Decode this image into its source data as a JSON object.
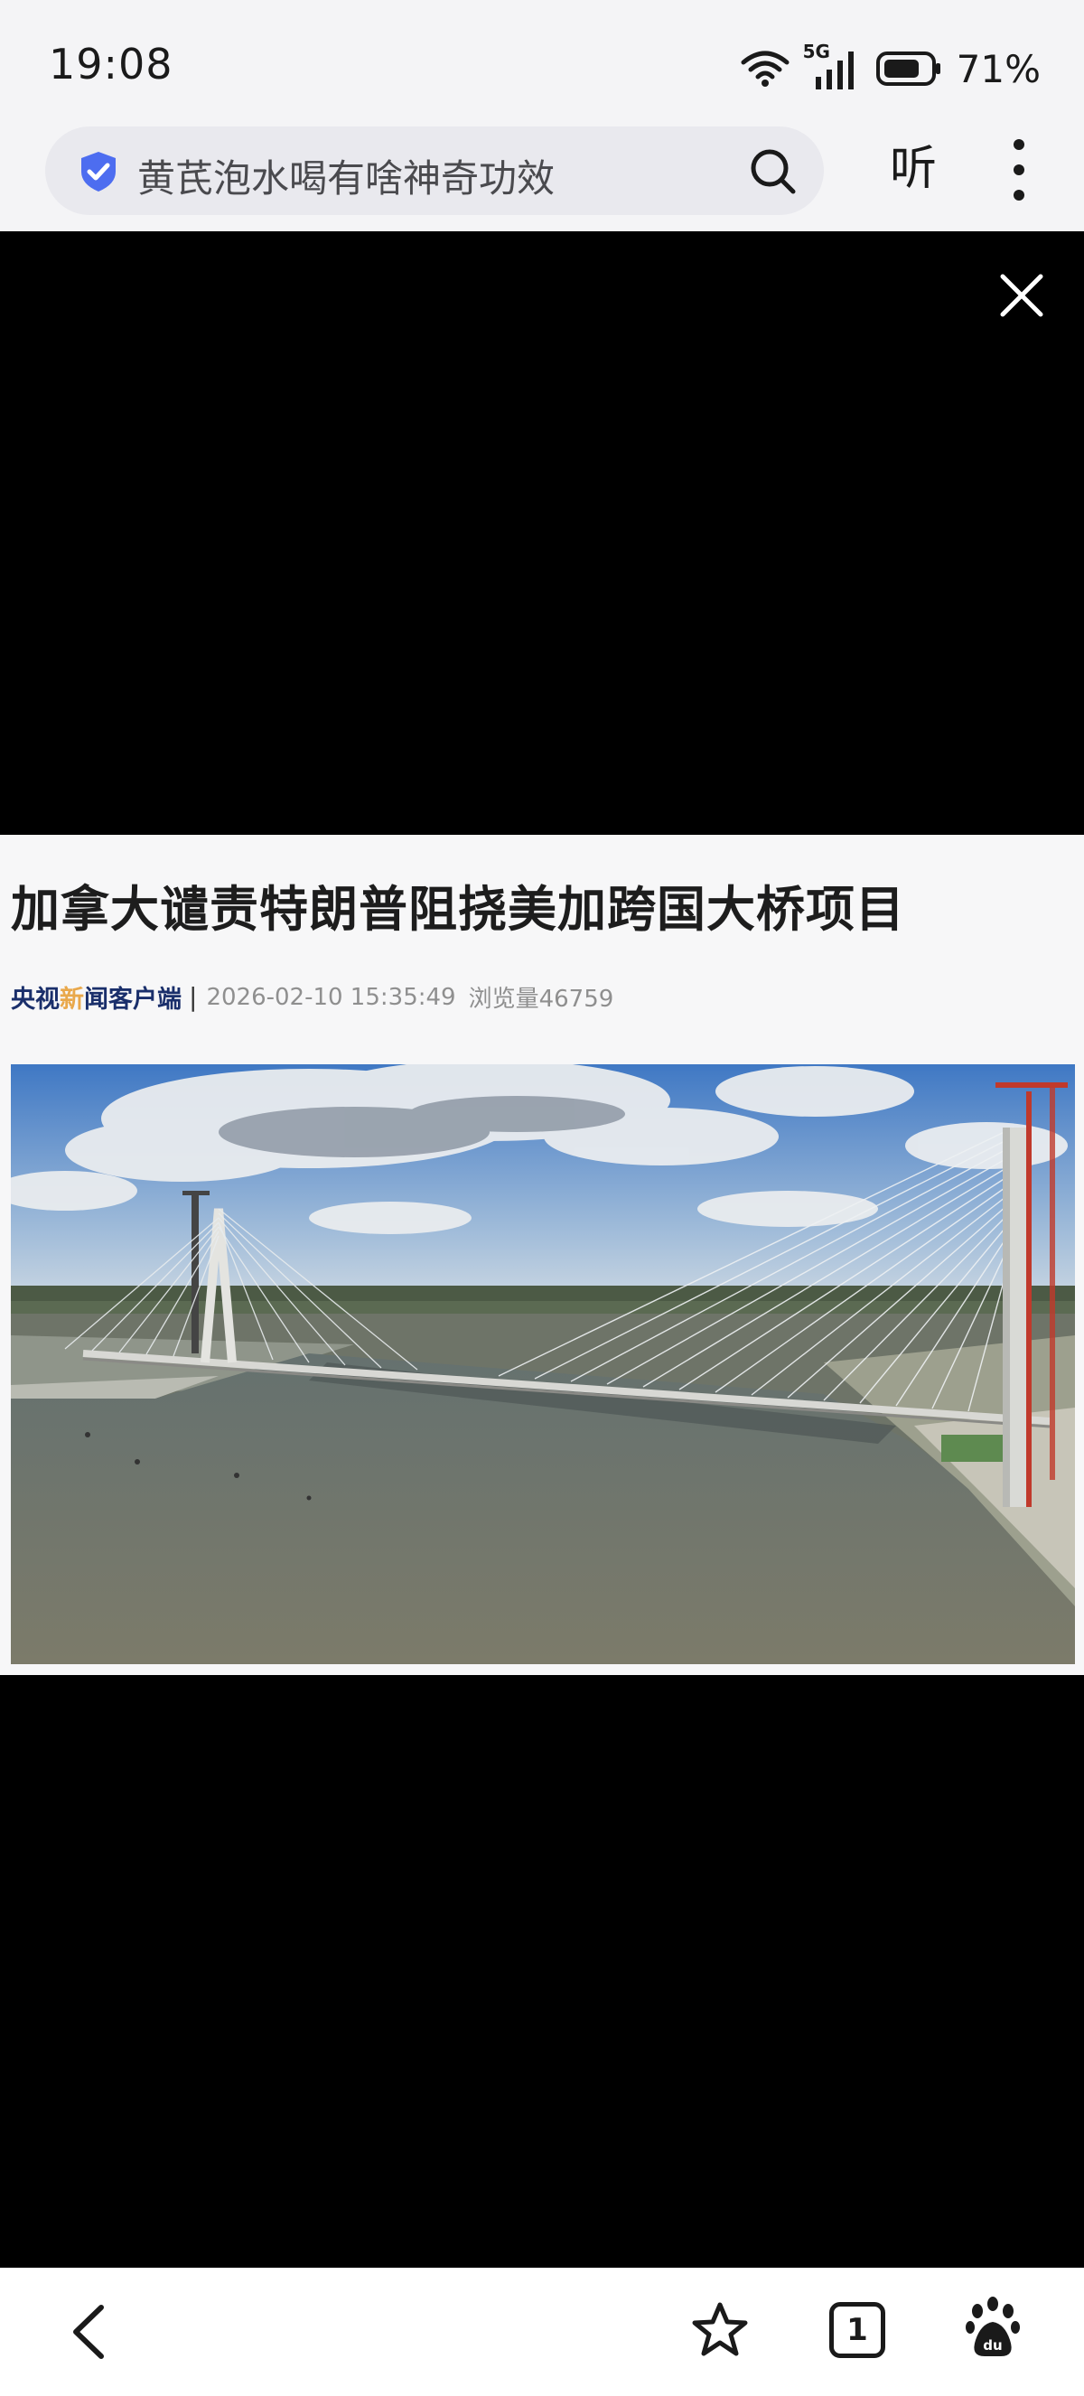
{
  "status_bar": {
    "time": "19:08",
    "network": "5G",
    "battery": "71%"
  },
  "address_bar": {
    "query": "黄芪泡水喝有啥神奇功效",
    "listen_label": "听"
  },
  "article": {
    "title": "加拿大谴责特朗普阻挠美加跨国大桥项目",
    "source_part1": "央视",
    "source_part2": "新",
    "source_part3": "闻客户端",
    "separator": "|",
    "datetime": "2026-02-10 15:35:49",
    "views": "浏览量46759"
  },
  "bottom_nav": {
    "tab_count": "1"
  },
  "colors": {
    "accent": "#4d6df0",
    "brand_dark": "#1a2f6b",
    "brand_orange": "#e9a84b"
  },
  "icons": [
    "wifi-icon",
    "signal-icon",
    "battery-icon",
    "shield-icon",
    "search-icon",
    "more-icon",
    "close-icon",
    "back-icon",
    "bookmark-icon",
    "tabs-icon",
    "baidu-icon"
  ]
}
